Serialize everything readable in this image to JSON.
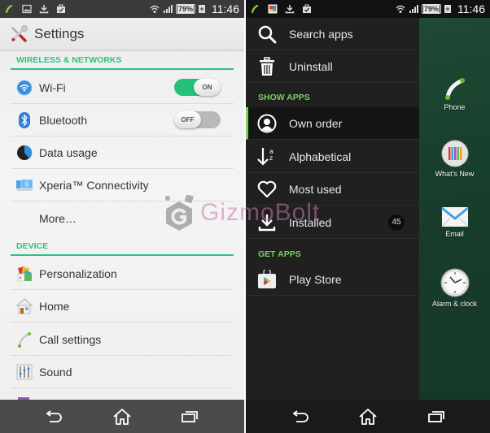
{
  "status_bar": {
    "time": "11:46",
    "battery_percent": "79%",
    "left_icons": [
      "phone-call-icon",
      "gallery-icon",
      "download-icon",
      "work-bag-icon"
    ],
    "right_icons": [
      "wifi-icon",
      "signal-icon",
      "battery-icon"
    ]
  },
  "settings": {
    "title": "Settings",
    "sections": [
      {
        "header": "WIRELESS & NETWORKS",
        "items": [
          {
            "label": "Wi-Fi",
            "icon": "wifi-icon",
            "toggle": "ON"
          },
          {
            "label": "Bluetooth",
            "icon": "bluetooth-icon",
            "toggle": "OFF"
          },
          {
            "label": "Data usage",
            "icon": "data-usage-icon"
          },
          {
            "label": "Xperia™ Connectivity",
            "icon": "xperia-connectivity-icon"
          },
          {
            "label": "More…",
            "icon": ""
          }
        ]
      },
      {
        "header": "DEVICE",
        "items": [
          {
            "label": "Personalization",
            "icon": "personalization-icon"
          },
          {
            "label": "Home",
            "icon": "home-icon"
          },
          {
            "label": "Call settings",
            "icon": "phone-icon"
          },
          {
            "label": "Sound",
            "icon": "equalizer-icon"
          }
        ]
      }
    ]
  },
  "drawer": {
    "items_top": [
      {
        "label": "Search apps",
        "icon": "search-icon"
      },
      {
        "label": "Uninstall",
        "icon": "trash-icon"
      }
    ],
    "show_apps_header": "SHOW APPS",
    "show_apps": [
      {
        "label": "Own order",
        "icon": "person-icon",
        "selected": true
      },
      {
        "label": "Alphabetical",
        "icon": "sort-alpha-icon"
      },
      {
        "label": "Most used",
        "icon": "heart-icon"
      },
      {
        "label": "Installed",
        "icon": "download-icon",
        "badge": "45"
      }
    ],
    "get_apps_header": "GET APPS",
    "get_apps": [
      {
        "label": "Play Store",
        "icon": "play-store-icon"
      }
    ]
  },
  "home_apps": [
    {
      "label": "Phone"
    },
    {
      "label": "What's New"
    },
    {
      "label": "Email"
    },
    {
      "label": "Alarm & clock"
    }
  ],
  "watermark": "GizmoBolt",
  "nav": {
    "back": "back-icon",
    "home": "home-icon",
    "recents": "recents-icon"
  },
  "colors": {
    "settings_accent": "#2ec27e",
    "drawer_accent": "#7ccf5c",
    "toggle_on": "#26c07a"
  }
}
